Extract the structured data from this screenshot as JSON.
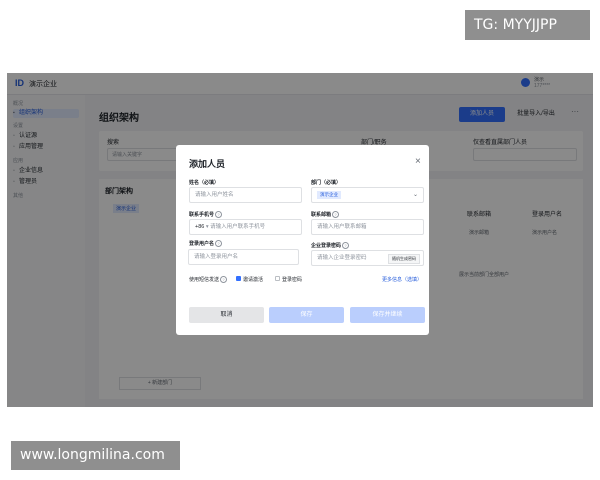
{
  "watermarks": {
    "top_right": "TG: MYYJJPP",
    "bottom_left": "www.longmilina.com"
  },
  "app": {
    "logo": "ID",
    "corp_name": "演示企业",
    "user": {
      "name": "演示",
      "phone": "177****"
    }
  },
  "sidebar": {
    "groups": [
      "概况",
      "设置",
      "应用",
      "其他"
    ],
    "items": [
      "组织架构",
      "认证源",
      "应用管理",
      "企业信息",
      "管理员"
    ]
  },
  "main": {
    "page_title": "组织架构",
    "add_button": "添加人员",
    "batch_button": "批量导入/导出",
    "more": "···",
    "filter": {
      "search_label": "搜索",
      "search_placeholder": "请输入关键字",
      "dept_label": "部门/职务",
      "leader_label": "仅查看直属部门人员"
    },
    "org_title": "部门架构",
    "org_node": "演示企业",
    "columns": [
      "联系邮箱",
      "登录用户名"
    ],
    "row": [
      "演示邮箱",
      "演示用户名"
    ],
    "pager": "展示当前部门全部用户",
    "add_dept": "+ 新建部门"
  },
  "modal": {
    "title": "添加人员",
    "close": "×",
    "name_label": "姓名（必填）",
    "name_placeholder": "请输入用户姓名",
    "dept_label": "部门（必填）",
    "dept_tag": "演示企业",
    "phone_label": "联系手机号",
    "phone_prefix": "+86",
    "phone_placeholder": "请输入用户联系手机号",
    "email_label": "联系邮箱",
    "email_placeholder": "请输入用户联系邮箱",
    "username_label": "登录用户名",
    "username_placeholder": "请输入登录用户名",
    "password_label": "企业登录密码",
    "password_placeholder": "请输入企业登录密码",
    "generate_button": "随机生成密码",
    "notify_label": "使用短信发送",
    "opt_invite": "邀请激活",
    "opt_password": "登录密码",
    "more_options": "更多信息（选填）",
    "cancel": "取消",
    "save": "保存",
    "save_add": "保存并继续"
  },
  "colors": {
    "primary": "#3370ff",
    "primary_light": "#bacefd",
    "overlay": "rgba(0,0,0,0.46)"
  }
}
